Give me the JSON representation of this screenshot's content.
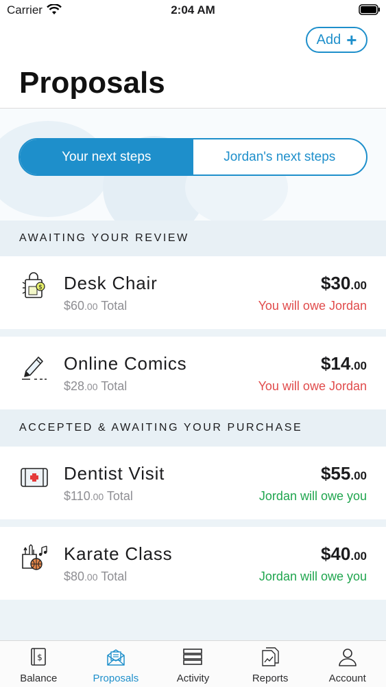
{
  "status_bar": {
    "carrier": "Carrier",
    "time": "2:04 AM"
  },
  "header": {
    "add_label": "Add",
    "title": "Proposals"
  },
  "segments": {
    "left": "Your next steps",
    "right": "Jordan's next steps",
    "selected": "left"
  },
  "sections": [
    {
      "title": "AWAITING YOUR REVIEW",
      "items": [
        {
          "icon": "shopping-bag-icon",
          "name": "Desk Chair",
          "total_dollars": "$60",
          "total_cents": ".00",
          "total_suffix": " Total",
          "amount_dollars": "$30",
          "amount_cents": ".00",
          "status": "You will owe Jordan",
          "status_color": "#e04b4b"
        },
        {
          "icon": "pencil-icon",
          "name": "Online Comics",
          "total_dollars": "$28",
          "total_cents": ".00",
          "total_suffix": " Total",
          "amount_dollars": "$14",
          "amount_cents": ".00",
          "status": "You will owe Jordan",
          "status_color": "#e04b4b"
        }
      ]
    },
    {
      "title": "ACCEPTED & AWAITING YOUR PURCHASE",
      "items": [
        {
          "icon": "first-aid-kit-icon",
          "name": "Dentist Visit",
          "total_dollars": "$110",
          "total_cents": ".00",
          "total_suffix": " Total",
          "amount_dollars": "$55",
          "amount_cents": ".00",
          "status": "Jordan will owe you",
          "status_color": "#1fa54e"
        },
        {
          "icon": "activities-icon",
          "name": "Karate Class",
          "total_dollars": "$80",
          "total_cents": ".00",
          "total_suffix": " Total",
          "amount_dollars": "$40",
          "amount_cents": ".00",
          "status": "Jordan will owe you",
          "status_color": "#1fa54e"
        }
      ]
    }
  ],
  "tabs": [
    {
      "label": "Balance",
      "icon": "balance-icon"
    },
    {
      "label": "Proposals",
      "icon": "proposals-icon",
      "active": true
    },
    {
      "label": "Activity",
      "icon": "activity-icon"
    },
    {
      "label": "Reports",
      "icon": "reports-icon"
    },
    {
      "label": "Account",
      "icon": "account-icon"
    }
  ],
  "colors": {
    "accent": "#1e8fcb",
    "negative": "#e04b4b",
    "positive": "#1fa54e",
    "section_bg": "#e8f0f5"
  }
}
